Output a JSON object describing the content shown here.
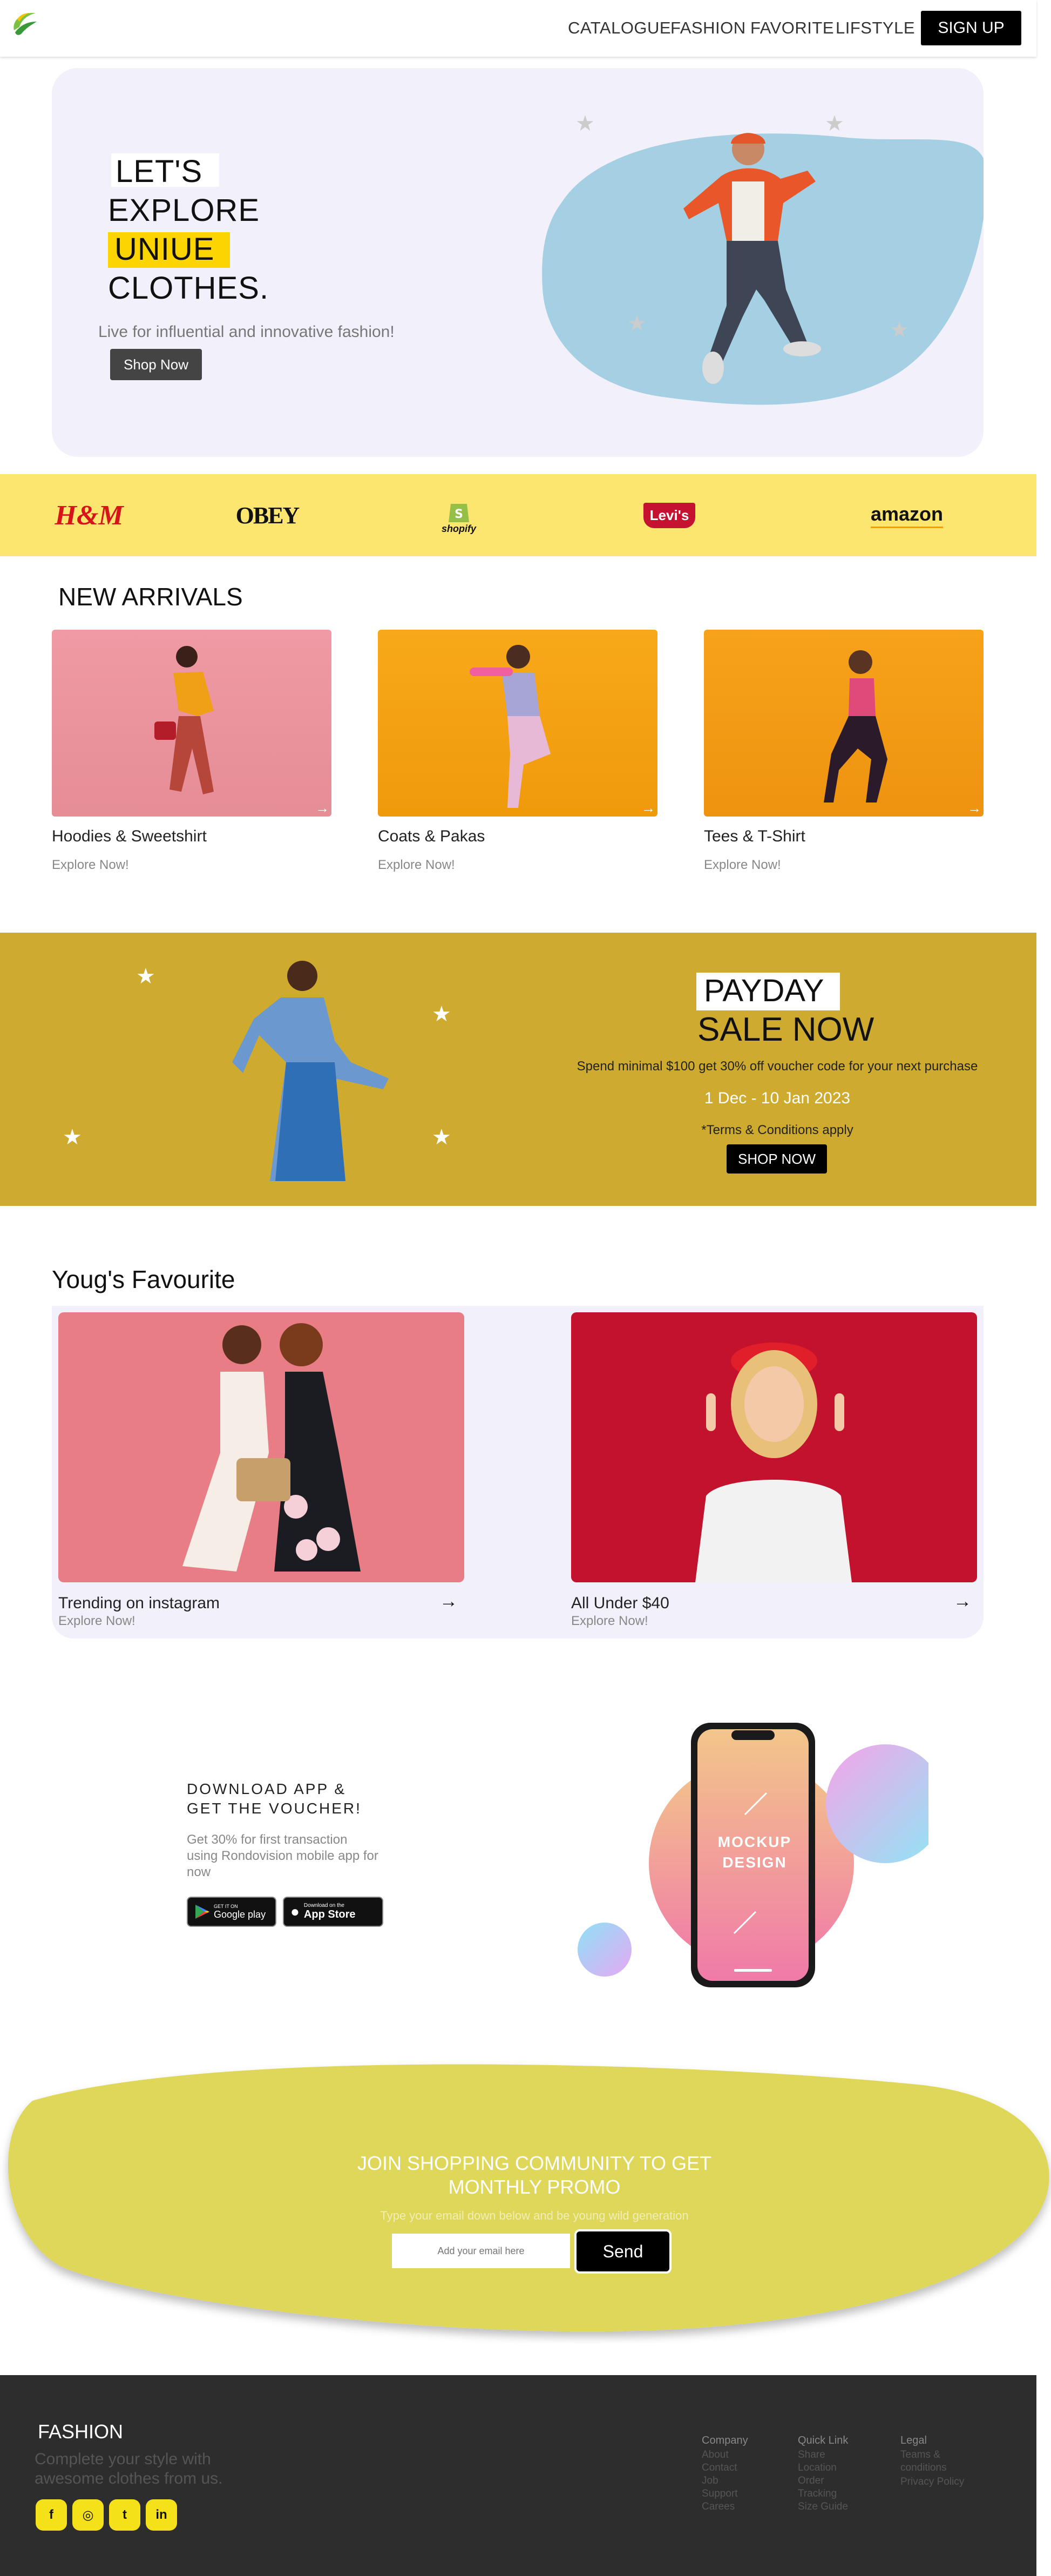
{
  "nav": {
    "links": [
      "CATALOGUE",
      "FASHION",
      "FAVORITE",
      "LIFSTYLE"
    ],
    "signup_label": "SIGN UP"
  },
  "hero": {
    "line1": "LET'S",
    "line2": "EXPLORE",
    "line3": "UNIUE",
    "line4": "CLOTHES.",
    "subtitle": "Live for influential and innovative fashion!",
    "cta_label": "Shop Now"
  },
  "brands": [
    "H&M",
    "OBEY",
    "shopify",
    "Levi's",
    "amazon"
  ],
  "new_arrivals": {
    "title": "NEW ARRIVALS",
    "items": [
      {
        "title": "Hoodies & Sweetshirt",
        "sub": "Explore Now!"
      },
      {
        "title": "Coats & Pakas",
        "sub": "Explore Now!"
      },
      {
        "title": "Tees & T-Shirt",
        "sub": "Explore Now!"
      }
    ]
  },
  "payday": {
    "line1": "PAYDAY",
    "line2": "SALE NOW",
    "desc": "Spend minimal $100 get 30% off voucher code for your next purchase",
    "dates": "1 Dec - 10 Jan 2023",
    "terms": "*Terms & Conditions apply",
    "cta_label": "SHOP NOW"
  },
  "favourite": {
    "title": "Youg's Favourite",
    "items": [
      {
        "title": "Trending on instagram",
        "sub": "Explore Now!"
      },
      {
        "title": "All Under $40",
        "sub": "Explore Now!"
      }
    ]
  },
  "app": {
    "title": "DOWNLOAD APP & GET THE VOUCHER!",
    "subtitle": "Get 30% for first transaction using Rondovision mobile app for now",
    "google_small": "GET IT ON",
    "google_big": "Google play",
    "apple_small": "Download on the",
    "apple_big": "App Store",
    "phone_text": "MOCKUP DESIGN"
  },
  "promo": {
    "title": "JOIN SHOPPING COMMUNITY TO GET MONTHLY PROMO",
    "subtitle": "Type your email down below and be young wild generation",
    "email_placeholder": "Add your email here",
    "send_label": "Send"
  },
  "footer": {
    "brand": "FASHION",
    "tagline": "Complete your style with awesome clothes from us.",
    "columns": [
      {
        "heading": "Company",
        "items": [
          "About",
          "Contact",
          "Job",
          "Support",
          "Carees"
        ]
      },
      {
        "heading": "Quick Link",
        "items": [
          "Share",
          "Location",
          "Order",
          "Tracking",
          "Size Guide"
        ]
      },
      {
        "heading": "Legal",
        "items": [
          "Teams & conditions",
          "Privacy Policy"
        ]
      }
    ]
  },
  "colors": {
    "accent_yellow": "#fcd400",
    "brand_bar": "#fce670",
    "payday_bg": "#ceaa2f",
    "promo_blob": "#dfd75a",
    "footer_bg": "#2d2d2d",
    "hero_blob": "#a5cfe2"
  }
}
